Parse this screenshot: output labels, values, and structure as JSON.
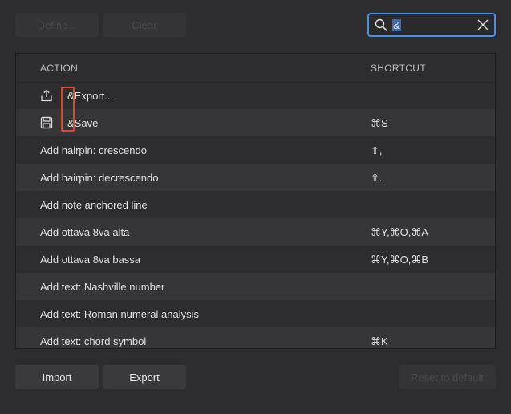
{
  "toolbar": {
    "define_label": "Define...",
    "clear_label": "Clear"
  },
  "search": {
    "value": "&"
  },
  "table": {
    "col_action": "ACTION",
    "col_shortcut": "SHORTCUT",
    "rows": [
      {
        "action": "&Export...",
        "shortcut": "",
        "icon": "export-icon"
      },
      {
        "action": "&Save",
        "shortcut": "⌘S",
        "icon": "save-icon"
      },
      {
        "action": "Add hairpin: crescendo",
        "shortcut": "⇧,"
      },
      {
        "action": "Add hairpin: decrescendo",
        "shortcut": "⇧."
      },
      {
        "action": "Add note anchored line",
        "shortcut": ""
      },
      {
        "action": "Add ottava 8va alta",
        "shortcut": "⌘Y,⌘O,⌘A"
      },
      {
        "action": "Add ottava 8va bassa",
        "shortcut": "⌘Y,⌘O,⌘B"
      },
      {
        "action": "Add text: Nashville number",
        "shortcut": ""
      },
      {
        "action": "Add text: Roman numeral analysis",
        "shortcut": ""
      },
      {
        "action": "Add text: chord symbol",
        "shortcut": "⌘K"
      }
    ]
  },
  "footer": {
    "import_label": "Import",
    "export_label": "Export",
    "reset_label": "Reset to default"
  },
  "colors": {
    "accent": "#4a90e2",
    "highlight": "#e0442c"
  }
}
